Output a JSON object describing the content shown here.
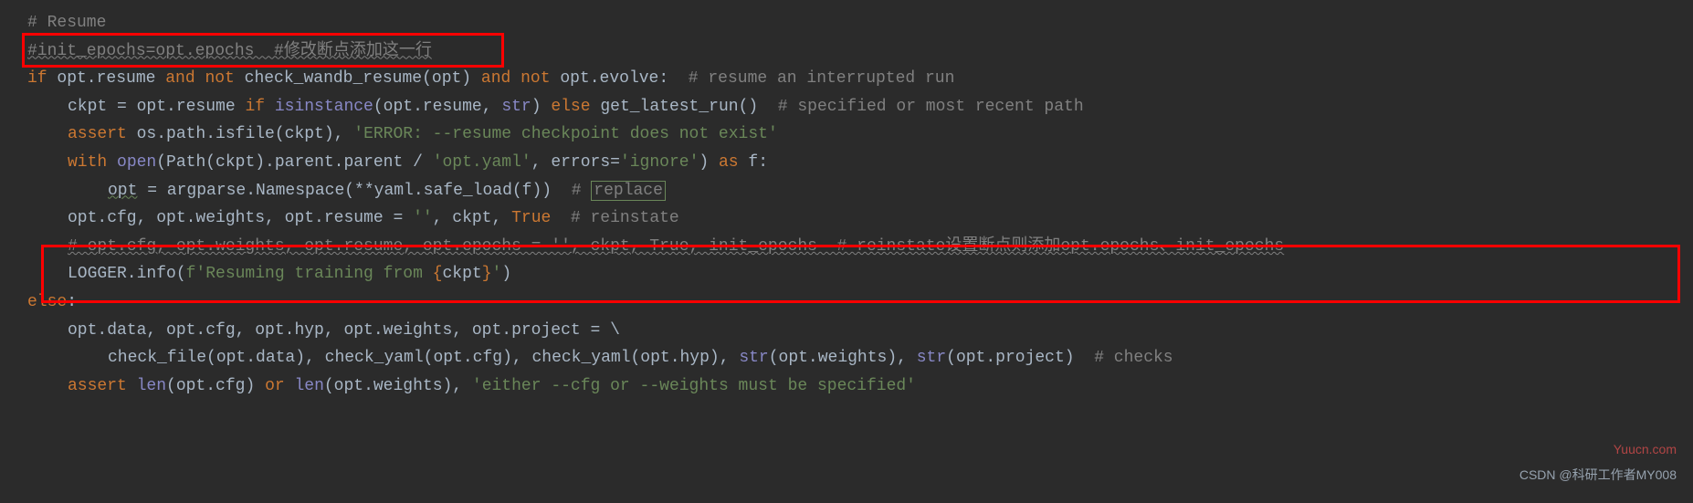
{
  "lines": {
    "l1_comment": "# Resume",
    "l2_comment": "#init_epochs=opt.epochs  #修改断点添加这一行",
    "l3": {
      "if": "if ",
      "opt_resume": "opt.resume ",
      "and1": "and not ",
      "check": "check_wandb_resume(opt) ",
      "and2": "and not ",
      "evolve": "opt.evolve:  ",
      "comment": "# resume an interrupted run"
    },
    "l4": {
      "ckpt": "ckpt = opt.resume ",
      "if": "if ",
      "isinstance": "isinstance",
      "args": "(opt.resume, ",
      "str": "str",
      "close": ") ",
      "else": "else ",
      "getrun": "get_latest_run()  ",
      "comment": "# specified or most recent path"
    },
    "l5": {
      "assert": "assert ",
      "ospath": "os.path.isfile(ckpt), ",
      "string": "'ERROR: --resume checkpoint does not exist'"
    },
    "l6": {
      "with": "with ",
      "open": "open",
      "args1": "(Path(ckpt).parent.parent / ",
      "str1": "'opt.yaml'",
      "comma": ", ",
      "errors": "errors",
      "eq": "=",
      "str2": "'ignore'",
      "close": ") ",
      "as": "as ",
      "f": "f:"
    },
    "l7": {
      "opt": "opt",
      "rest": " = argparse.Namespace(**yaml.safe_load(f))  ",
      "hash": "# ",
      "replace": "replace"
    },
    "l8": {
      "vars": "opt.cfg, opt.weights, opt.resume = ",
      "str": "''",
      "comma1": ", ckpt, ",
      "true": "True  ",
      "comment": "# reinstate"
    },
    "l9_comment": "# opt.cfg, opt.weights, opt.resume, opt.epochs = '', ckpt, True, init_epochs  # reinstate设置断点则添加opt.epochs、init_epochs",
    "l10": {
      "logger": "LOGGER.info(",
      "fprefix": "f'Resuming training from ",
      "brace_open": "{",
      "ckpt": "ckpt",
      "brace_close": "}",
      "fsuffix": "'",
      "close": ")"
    },
    "l11": {
      "else": "else",
      "colon": ":"
    },
    "l12": {
      "vars": "opt.data, opt.cfg, opt.hyp, opt.weights, opt.project = \\"
    },
    "l13": {
      "calls": "check_file(opt.data), check_yaml(opt.cfg), check_yaml(opt.hyp), ",
      "str1": "str",
      "args1": "(opt.weights), ",
      "str2": "str",
      "args2": "(opt.project)  ",
      "comment": "# checks"
    },
    "l14": {
      "assert": "assert ",
      "len1": "len",
      "args1": "(opt.cfg) ",
      "or": "or ",
      "len2": "len",
      "args2": "(opt.weights), ",
      "string": "'either --cfg or --weights must be specified'"
    }
  },
  "watermark": "Yuucn.com",
  "attribution": "CSDN @科研工作者MY008"
}
